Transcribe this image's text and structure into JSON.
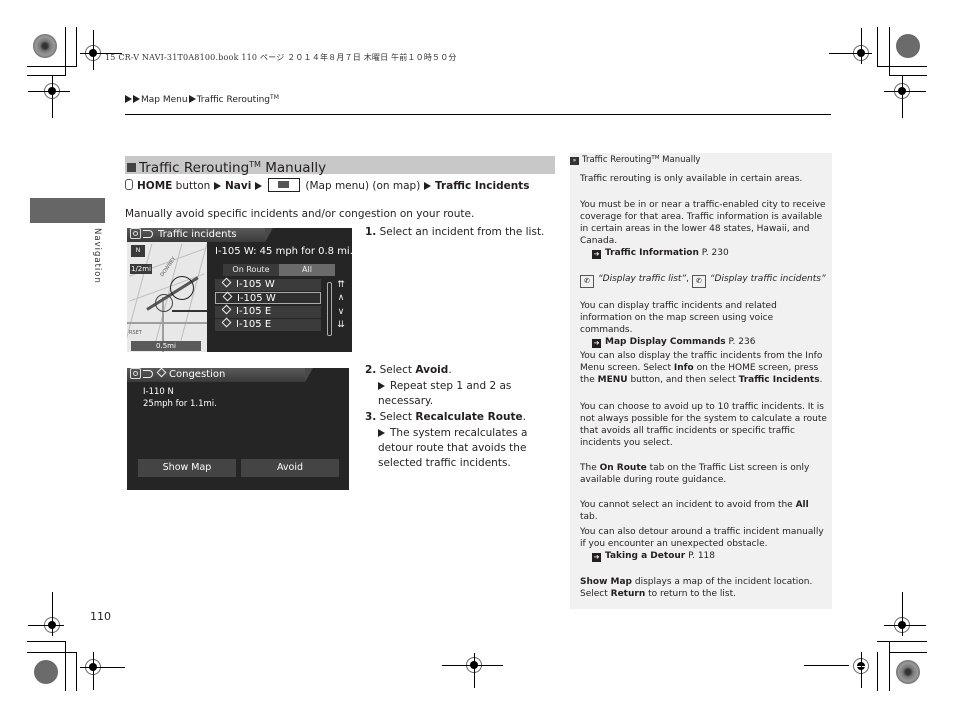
{
  "print_header": "15 CR-V NAVI-31T0A8100.book  110 ページ  ２０１４年８月７日  木曜日  午前１０時５０分",
  "breadcrumb": {
    "items": [
      "Map Menu",
      "Traffic Rerouting"
    ],
    "tm": "TM"
  },
  "side_tab": {
    "label": "Navigation"
  },
  "section": {
    "title_pre": "Traffic Rerouting",
    "title_tm": "TM",
    "title_post": " Manually",
    "path": {
      "home": "HOME",
      "button_word": " button ",
      "navi": "Navi",
      "map_menu_note": " (Map menu) (on map) ",
      "target": "Traffic Incidents"
    },
    "intro": "Manually avoid specific incidents and/or congestion on your route."
  },
  "screen1": {
    "title": "Traffic incidents",
    "incident_header": "I-105 W: 45 mph for 0.8 mi.",
    "tabs": [
      "On Route",
      "All"
    ],
    "active_tab": "All",
    "list": [
      "I-105 W",
      "I-105 W",
      "I-105 E",
      "I-105 E"
    ],
    "selected_index": 1,
    "map": {
      "north": "N",
      "scale_badge": "1/2mi",
      "scale_bar": "0.5mi",
      "street": "DOWNEY",
      "street2": "RSET"
    },
    "scroll": [
      "⇈",
      "∧",
      "∨",
      "⇊"
    ]
  },
  "screen2": {
    "title": "Congestion",
    "road": "I-110 N",
    "detail": "25mph for 1.1mi.",
    "buttons": [
      "Show Map",
      "Avoid"
    ]
  },
  "steps": [
    {
      "num": "1.",
      "text": "Select an incident from the list."
    },
    {
      "num": "2.",
      "pre": "Select ",
      "bold": "Avoid",
      "post": ".",
      "sub": "Repeat step 1 and 2 as necessary."
    },
    {
      "num": "3.",
      "pre": "Select ",
      "bold": "Recalculate Route",
      "post": ".",
      "sub": "The system recalculates a detour route that avoids the selected traffic incidents."
    }
  ],
  "notes": {
    "header_pre": "Traffic Rerouting",
    "header_tm": "TM",
    "header_post": " Manually",
    "p1": "Traffic rerouting is only available in certain areas.",
    "p2": "You must be in or near a traffic-enabled city to receive coverage for that area. Traffic information is available in certain areas in the lower 48 states, Hawaii, and Canada.",
    "xref1": {
      "label": "Traffic Information",
      "page": " P. 230"
    },
    "voice1": "“Display traffic list”",
    "voice2": "“Display traffic incidents”",
    "p3": "You can display traffic incidents and related information on the map screen using voice commands.",
    "xref2": {
      "label": "Map Display Commands",
      "page": " P. 236"
    },
    "p4": {
      "a": "You can also display the traffic incidents from the Info Menu screen. Select ",
      "b1": "Info",
      "c": " on the HOME screen, press the ",
      "b2": "MENU",
      "d": " button, and then select ",
      "b3": "Traffic Incidents",
      "e": "."
    },
    "p5": "You can choose to avoid up to 10 traffic incidents. It is not always possible for the system to calculate a route that avoids all traffic incidents or specific traffic incidents you select.",
    "p6": {
      "a": "The ",
      "b": "On Route",
      "c": " tab on the Traffic List screen is only available during route guidance."
    },
    "p7": {
      "a": "You cannot select an incident to avoid from the ",
      "b": "All",
      "c": " tab."
    },
    "p8": "You can also detour around a traffic incident manually if you encounter an unexpected obstacle.",
    "xref3": {
      "label": "Taking a Detour",
      "page": " P. 118"
    },
    "p9": {
      "b1": "Show Map",
      "a": " displays a map of the incident location. Select ",
      "b2": "Return",
      "c": " to return to the list."
    }
  },
  "page_number": "110"
}
